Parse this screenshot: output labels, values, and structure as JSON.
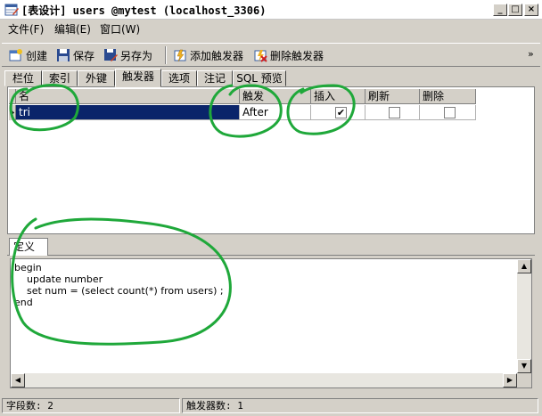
{
  "window": {
    "title": "[表设计] users @mytest (localhost_3306)",
    "minimize": "_",
    "maximize": "□",
    "close": "×"
  },
  "menu": {
    "items": [
      {
        "label": "文件(F)"
      },
      {
        "label": "编辑(E)"
      },
      {
        "label": "窗口(W)"
      }
    ]
  },
  "toolbar": {
    "new_label": "创建",
    "save_label": "保存",
    "save_as_label": "另存为",
    "add_trigger_label": "添加触发器",
    "delete_trigger_label": "删除触发器",
    "overflow": "»"
  },
  "tabs": [
    {
      "label": "栏位"
    },
    {
      "label": "索引"
    },
    {
      "label": "外键"
    },
    {
      "label": "触发器",
      "active": true
    },
    {
      "label": "选项"
    },
    {
      "label": "注记"
    },
    {
      "label": "SQL 预览"
    }
  ],
  "grid": {
    "columns": [
      "名",
      "触发",
      "插入",
      "刷新",
      "删除"
    ],
    "rows": [
      {
        "name": "tri",
        "timing": "After",
        "insert": true,
        "update": false,
        "delete": false,
        "insert_mark": "✔"
      }
    ]
  },
  "definition": {
    "tab_label": "定义",
    "code_lines": [
      "begin",
      "    update number",
      "    set num = (select count(*) from users) ;",
      "end"
    ]
  },
  "status": {
    "field_count": "字段数: 2",
    "trigger_count": "触发器数: 1"
  },
  "colors": {
    "annotation": "#1fa83a",
    "selection": "#0a246a",
    "face": "#d4d0c8"
  }
}
